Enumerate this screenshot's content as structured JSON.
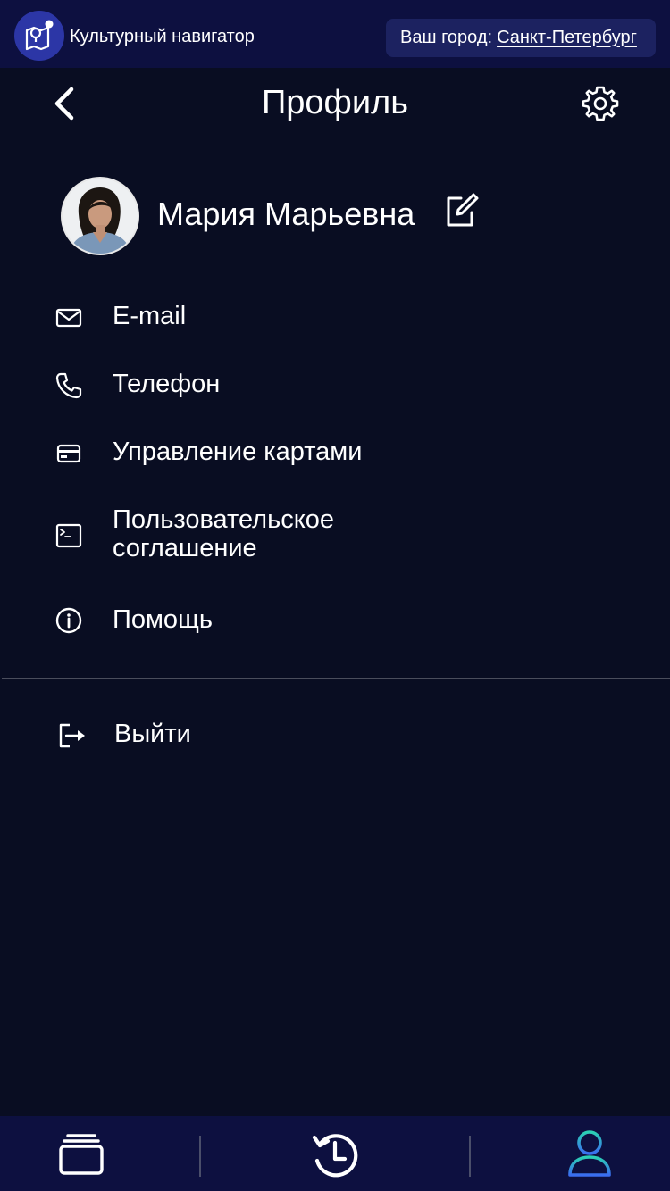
{
  "app": {
    "name": "Культурный навигатор",
    "city_label": "Ваш город:",
    "city_value": "Санкт-Петербург"
  },
  "header": {
    "title": "Профиль"
  },
  "profile": {
    "name": "Мария Марьевна"
  },
  "menu": {
    "items": [
      {
        "label": "E-mail",
        "icon": "mail-icon"
      },
      {
        "label": "Телефон",
        "icon": "phone-icon"
      },
      {
        "label": "Управление картами",
        "icon": "card-icon"
      },
      {
        "label": "Пользовательское соглашение",
        "icon": "terminal-icon"
      },
      {
        "label": "Помощь",
        "icon": "info-icon"
      }
    ],
    "logout_label": "Выйти"
  },
  "bottom_nav": {
    "items": [
      "cards-icon",
      "history-icon",
      "profile-icon"
    ],
    "active": "profile-icon"
  },
  "colors": {
    "background": "#090d22",
    "bar": "#0d1040",
    "city_box": "#1c2260",
    "logo": "#2c36a6",
    "active_gradient_start": "#2bd0b4",
    "active_gradient_end": "#3a6df0"
  }
}
